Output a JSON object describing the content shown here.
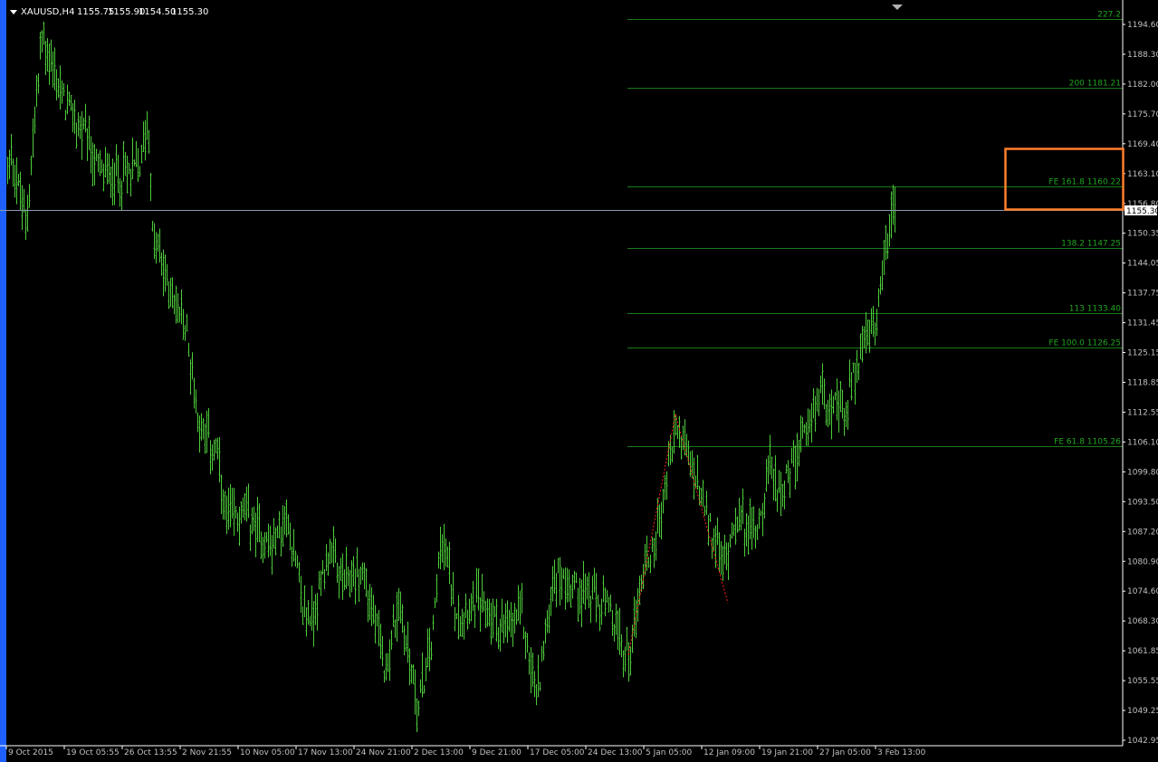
{
  "window": {
    "symbol": "XAUUSD,H4",
    "quote": {
      "open": "1155.75",
      "high": "1155.90",
      "low": "1154.50",
      "close": "1155.30"
    }
  },
  "colors": {
    "background": "#000000",
    "bars": "#4dcc3a",
    "fibo_lines": "#1a7a1a",
    "fibo_text": "#1fa51f",
    "bid_line": "#8c9ab0",
    "axis": "#ffffff",
    "axis_text": "#c0c0c0",
    "highlight_box": "#ff7f2a",
    "zigzag": "#ff2020",
    "left_edge": "#1e60ff"
  },
  "chart_data": {
    "type": "ohlc",
    "timeframe": "H4",
    "symbol": "XAUUSD",
    "ylim": [
      1042.95,
      1198.5
    ],
    "grid": false,
    "price_labels": [
      "1194.60",
      "1188.30",
      "1182.00",
      "1175.70",
      "1169.40",
      "1163.10",
      "1156.80",
      "1150.35",
      "1144.05",
      "1137.75",
      "1131.45",
      "1125.15",
      "1118.85",
      "1112.55",
      "1106.10",
      "1099.80",
      "1093.50",
      "1087.20",
      "1080.90",
      "1074.60",
      "1068.30",
      "1061.85",
      "1055.55",
      "1049.25",
      "1042.95"
    ],
    "current_price": {
      "label": "1155.30",
      "value": 1155.3
    },
    "time_labels": [
      "9 Oct 2015",
      "19 Oct 05:55",
      "26 Oct 13:55",
      "2 Nov 21:55",
      "10 Nov 05:00",
      "17 Nov 13:00",
      "24 Nov 21:00",
      "2 Dec 13:00",
      "9 Dec 21:00",
      "17 Dec 05:00",
      "24 Dec 13:00",
      "5 Jan 05:00",
      "12 Jan 09:00",
      "19 Jan 21:00",
      "27 Jan 05:00",
      "3 Feb 13:00"
    ],
    "price_path": [
      [
        0,
        1155
      ],
      [
        12,
        1168
      ],
      [
        28,
        1152
      ],
      [
        46,
        1192
      ],
      [
        70,
        1178
      ],
      [
        90,
        1172
      ],
      [
        110,
        1163
      ],
      [
        140,
        1163
      ],
      [
        155,
        1165
      ],
      [
        163,
        1176
      ],
      [
        168,
        1150
      ],
      [
        188,
        1138
      ],
      [
        205,
        1130
      ],
      [
        220,
        1110
      ],
      [
        240,
        1103
      ],
      [
        248,
        1090
      ],
      [
        270,
        1091
      ],
      [
        300,
        1084
      ],
      [
        318,
        1090
      ],
      [
        335,
        1070
      ],
      [
        345,
        1069
      ],
      [
        362,
        1083
      ],
      [
        380,
        1076
      ],
      [
        400,
        1079
      ],
      [
        425,
        1058
      ],
      [
        440,
        1072
      ],
      [
        462,
        1050
      ],
      [
        478,
        1066
      ],
      [
        486,
        1087
      ],
      [
        505,
        1070
      ],
      [
        525,
        1073
      ],
      [
        545,
        1069
      ],
      [
        560,
        1066
      ],
      [
        575,
        1071
      ],
      [
        592,
        1052
      ],
      [
        612,
        1078
      ],
      [
        630,
        1076
      ],
      [
        650,
        1074
      ],
      [
        672,
        1070
      ],
      [
        690,
        1061
      ],
      [
        697,
        1063
      ],
      [
        708,
        1078
      ],
      [
        720,
        1083
      ],
      [
        735,
        1097
      ],
      [
        746,
        1110
      ],
      [
        760,
        1103
      ],
      [
        772,
        1095
      ],
      [
        790,
        1084
      ],
      [
        800,
        1080
      ],
      [
        812,
        1091
      ],
      [
        830,
        1087
      ],
      [
        840,
        1091
      ],
      [
        850,
        1101
      ],
      [
        860,
        1096
      ],
      [
        870,
        1099
      ],
      [
        880,
        1103
      ],
      [
        895,
        1110
      ],
      [
        905,
        1118
      ],
      [
        918,
        1114
      ],
      [
        932,
        1112
      ],
      [
        942,
        1120
      ],
      [
        955,
        1128
      ],
      [
        968,
        1130
      ],
      [
        976,
        1144
      ],
      [
        982,
        1152
      ],
      [
        988,
        1155.3
      ]
    ],
    "fibonacci": {
      "label_right_x": 1238,
      "levels": [
        {
          "label": "227.2",
          "value": 1195.8
        },
        {
          "label": "200 1181.21",
          "value": 1181.21
        },
        {
          "label": "FE 161.8 1160.22",
          "value": 1160.22
        },
        {
          "label": "138.2 1147.25",
          "value": 1147.25
        },
        {
          "label": "113 1133.40",
          "value": 1133.4
        },
        {
          "label": "FE 100.0 1126.25",
          "value": 1126.25
        },
        {
          "label": "FE 61.8 1105.26",
          "value": 1105.26
        }
      ]
    },
    "zigzag": [
      [
        694,
        1061
      ],
      [
        746,
        1112
      ],
      [
        804,
        1072
      ]
    ]
  }
}
